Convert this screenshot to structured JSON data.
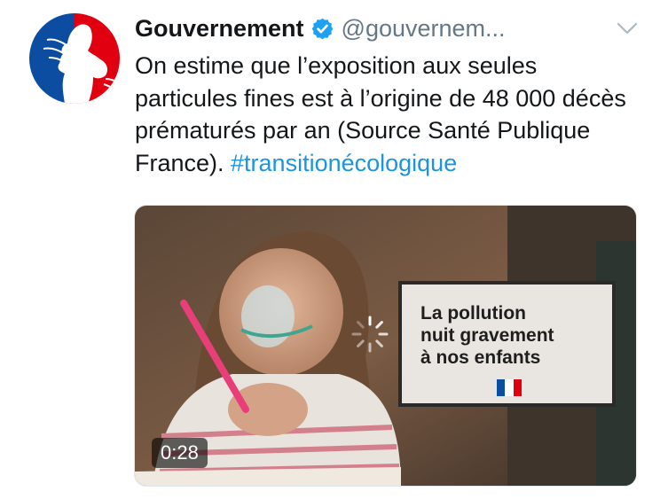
{
  "tweet": {
    "author_name": "Gouvernement",
    "handle": "@gouvernem...",
    "text": "On estime que l’exposition aux seules particules fines est à l’origine de 48 000 décès prématurés par an (Source Santé Publique France). ",
    "hashtag": "#transitionécologique"
  },
  "icons": {
    "avatar": "marianne-logo",
    "verified": "verified-badge-icon",
    "menu": "chevron-down-icon",
    "loading": "loading-spinner-icon",
    "flag": "french-flag-icon"
  },
  "video": {
    "duration": "0:28",
    "card_lines": [
      "La pollution",
      "nuit gravement",
      "à nos enfants"
    ]
  },
  "colors": {
    "text": "#14171a",
    "secondary": "#657786",
    "link": "#1b95e0",
    "verified": "#1da1f2",
    "tricolor_blue": "#0c4da2",
    "tricolor_red": "#e1000f"
  }
}
